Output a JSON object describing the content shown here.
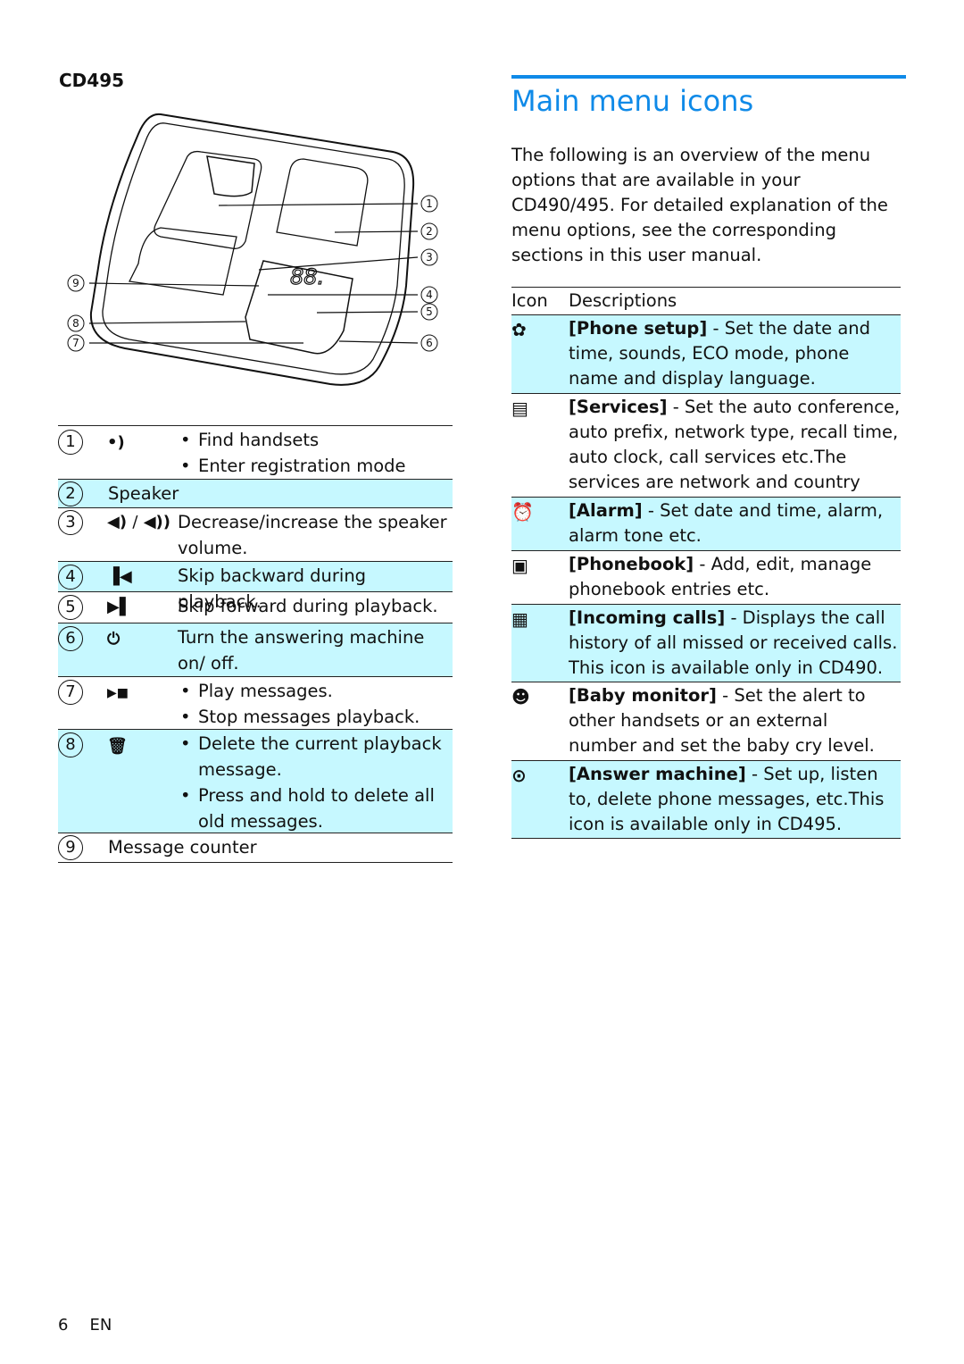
{
  "model": "CD495",
  "illustration": {
    "display": "88.",
    "callouts": [
      "1",
      "2",
      "3",
      "4",
      "5",
      "6",
      "7",
      "8",
      "9"
    ]
  },
  "left_table": [
    {
      "num": "1",
      "icon": "find-handsets-icon",
      "items": [
        "Find handsets",
        "Enter registration mode"
      ]
    },
    {
      "num": "2",
      "text": "Speaker"
    },
    {
      "num": "3",
      "icon": "volume-icon",
      "icon_text": "/",
      "text": "Decrease/increase the speaker volume."
    },
    {
      "num": "4",
      "icon": "skip-back-icon",
      "text": "Skip backward during playback."
    },
    {
      "num": "5",
      "icon": "skip-forward-icon",
      "text": "Skip forward during playback."
    },
    {
      "num": "6",
      "icon": "power-icon",
      "text": "Turn the answering machine on/ off."
    },
    {
      "num": "7",
      "icon": "play-stop-icon",
      "items": [
        "Play messages.",
        "Stop messages playback."
      ]
    },
    {
      "num": "8",
      "icon": "delete-icon",
      "items": [
        "Delete the current playback message.",
        "Press and hold to delete all old messages."
      ]
    },
    {
      "num": "9",
      "text": "Message counter"
    }
  ],
  "heading": "Main menu icons",
  "intro": "The following is an overview of the menu options that are available in your CD490/495. For detailed explanation of the menu options, see the corresponding sections in this user manual.",
  "right_table": {
    "headers": [
      "Icon",
      "Descriptions"
    ],
    "rows": [
      {
        "icon": "gear-icon",
        "name": "[Phone setup]",
        "desc": " - Set the date and time, sounds, ECO mode, phone name and display language."
      },
      {
        "icon": "briefcase-icon",
        "name": "[Services]",
        "desc": " - Set the auto conference, auto prefix, network type, recall time, auto clock, call services etc.The services are network and country dependent."
      },
      {
        "icon": "alarm-clock-icon",
        "name": "[Alarm]",
        "desc": " - Set date and time, alarm, alarm tone etc."
      },
      {
        "icon": "phonebook-icon",
        "name": "[Phonebook]",
        "desc": " - Add, edit, manage phonebook entries etc."
      },
      {
        "icon": "incoming-calls-icon",
        "name": "[Incoming calls]",
        "desc": " - Displays the call history of all missed or received calls. This icon is available only in CD490."
      },
      {
        "icon": "baby-monitor-icon",
        "name": "[Baby monitor]",
        "desc": " - Set the alert to other handsets or an external number and set the baby cry level."
      },
      {
        "icon": "answer-machine-icon",
        "name": "[Answer machine]",
        "desc": " - Set up, listen to, delete phone messages, etc.This icon is available only in CD495."
      }
    ]
  },
  "footer": {
    "page": "6",
    "lang": "EN"
  },
  "colors": {
    "accent": "#0f8ae8",
    "row_highlight": "#c6f8ff"
  }
}
